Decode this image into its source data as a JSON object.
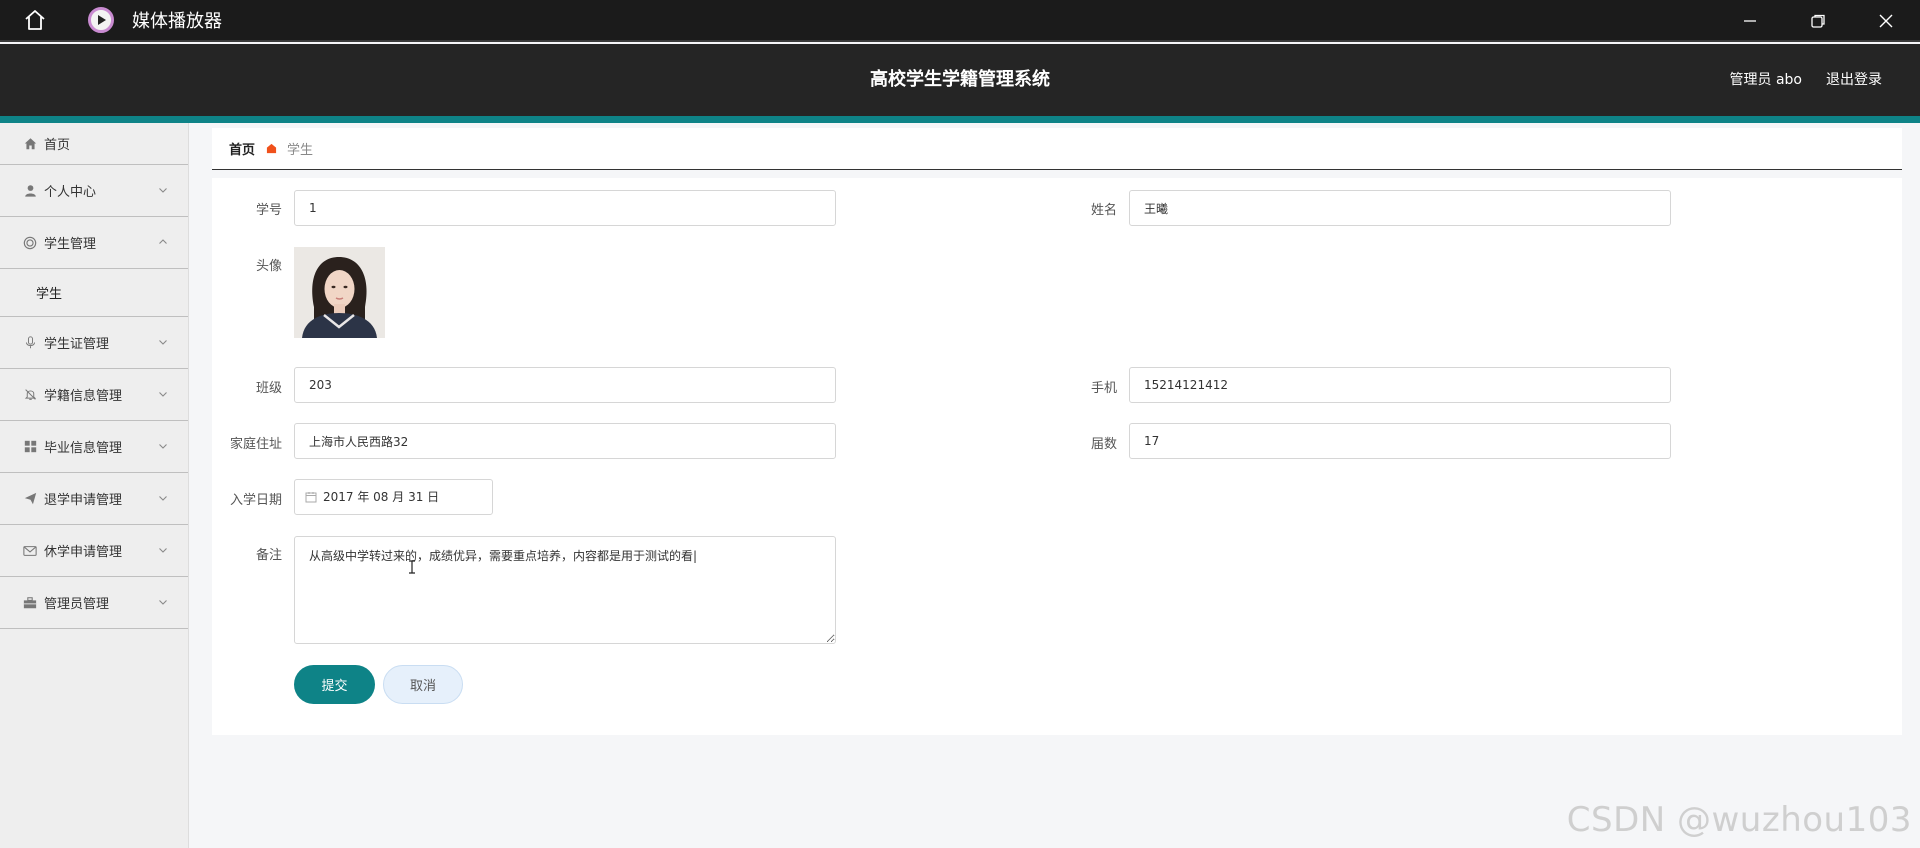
{
  "window": {
    "title": "媒体播放器",
    "icons": [
      "home-icon",
      "media-player-logo-icon",
      "minimize-icon",
      "restore-icon",
      "close-icon"
    ]
  },
  "header": {
    "title": "高校学生学籍管理系统",
    "user": "管理员 abo",
    "logout": "退出登录"
  },
  "sidebar": {
    "items": [
      {
        "label": "首页",
        "icon": "home-icon"
      },
      {
        "label": "个人中心",
        "icon": "user-icon"
      },
      {
        "label": "学生管理",
        "icon": "circle-icon",
        "expanded": true,
        "sub": "学生"
      },
      {
        "label": "学生证管理",
        "icon": "microphone-icon"
      },
      {
        "label": "学籍信息管理",
        "icon": "bell-off-icon"
      },
      {
        "label": "毕业信息管理",
        "icon": "grid-icon"
      },
      {
        "label": "退学申请管理",
        "icon": "send-icon"
      },
      {
        "label": "休学申请管理",
        "icon": "mail-icon"
      },
      {
        "label": "管理员管理",
        "icon": "briefcase-icon"
      }
    ]
  },
  "breadcrumb": {
    "home": "首页",
    "current": "学生"
  },
  "form": {
    "student_id": {
      "label": "学号",
      "value": "1"
    },
    "name": {
      "label": "姓名",
      "value": "王曦"
    },
    "avatar": {
      "label": "头像"
    },
    "class": {
      "label": "班级",
      "value": "203"
    },
    "phone": {
      "label": "手机",
      "value": "15214121412"
    },
    "address": {
      "label": "家庭住址",
      "value": "上海市人民西路32"
    },
    "grade": {
      "label": "届数",
      "value": "17"
    },
    "enroll_date": {
      "label": "入学日期",
      "value": "2017 年 08 月 31 日"
    },
    "remark": {
      "label": "备注",
      "value": "从高级中学转过来的，成绩优异，需要重点培养，内容都是用于测试的看|"
    },
    "submit": "提交",
    "cancel": "取消"
  },
  "watermark": "CSDN @wuzhou103",
  "colors": {
    "accent": "#0e8387",
    "header_bg": "#252525",
    "titlebar_bg": "#1b1b1b",
    "sidebar_bg": "#eeeeee",
    "breadcrumb_sep": "#f0511b"
  }
}
